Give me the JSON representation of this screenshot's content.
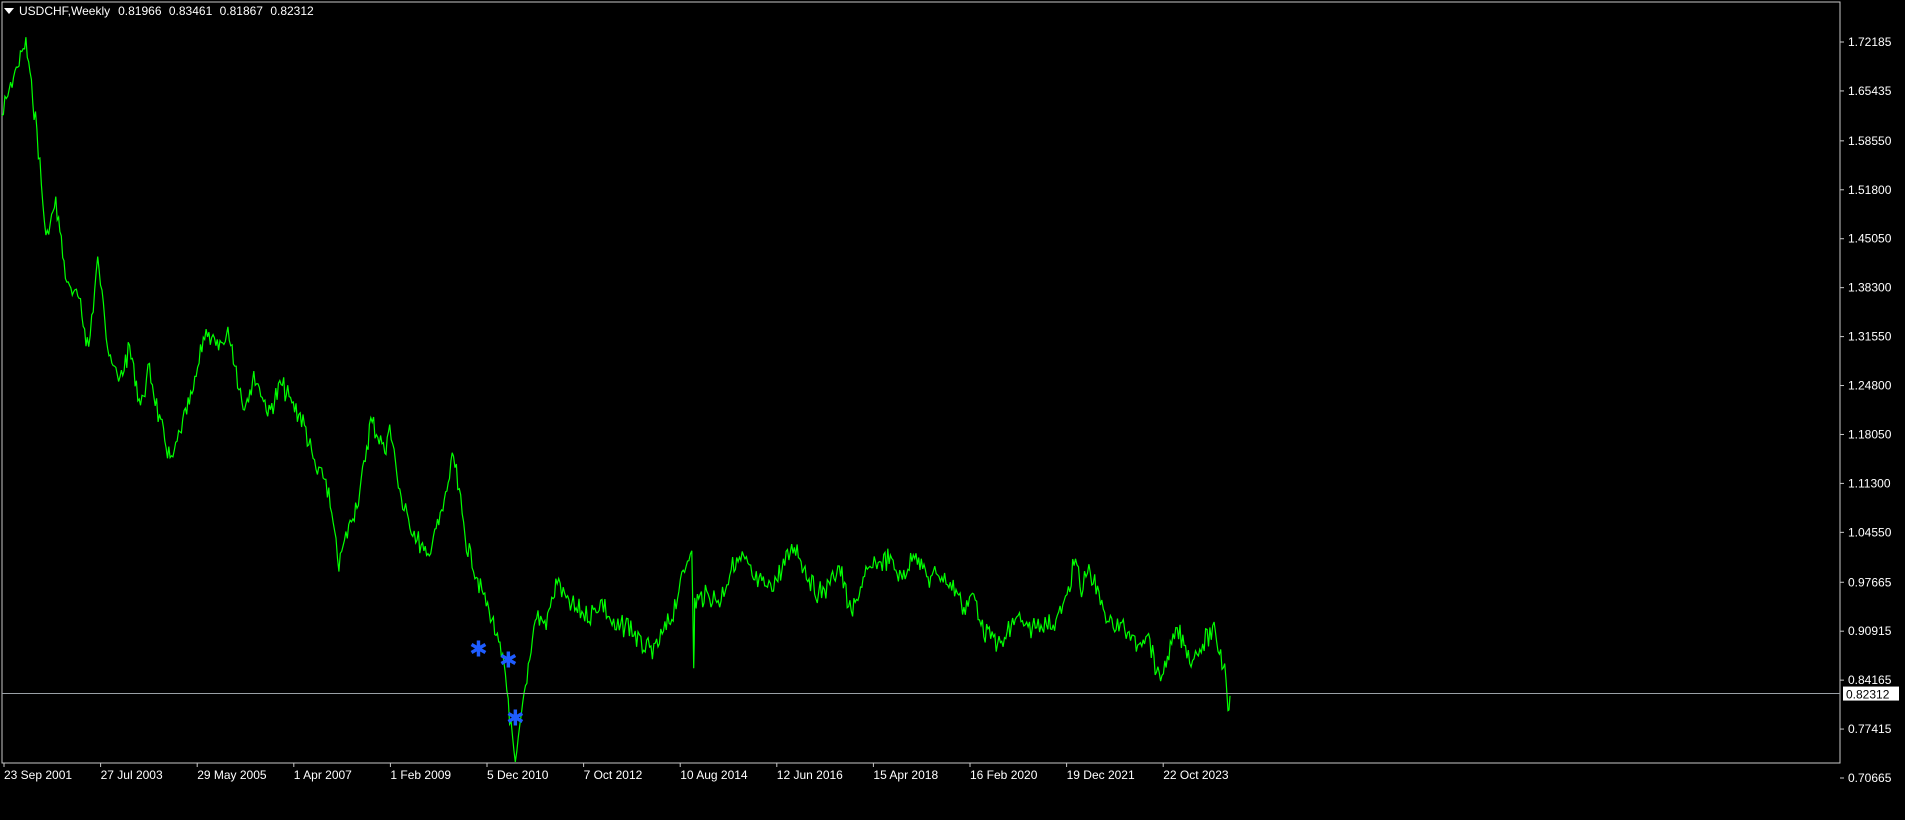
{
  "header": {
    "symbol_timeframe": "USDCHF,Weekly",
    "open": "0.81966",
    "high": "0.83461",
    "low": "0.81867",
    "close": "0.82312"
  },
  "colors": {
    "background": "#000000",
    "price_line": "#00ff00",
    "marker": "#1e5cff",
    "axis_text": "#ffffff",
    "frame": "#c8c8c8"
  },
  "chart_data": {
    "type": "line",
    "title": "USDCHF,Weekly",
    "xlabel": "",
    "ylabel": "",
    "ylim": [
      0.67,
      1.765
    ],
    "grid": false,
    "y_ticks": [
      "1.72185",
      "1.65435",
      "1.58550",
      "1.51800",
      "1.45050",
      "1.38300",
      "1.31550",
      "1.24800",
      "1.18050",
      "1.11300",
      "1.04550",
      "0.97665",
      "0.90915",
      "0.84165",
      "0.77415",
      "0.70665"
    ],
    "x_ticks": [
      "23 Sep 2001",
      "27 Jul 2003",
      "29 May 2005",
      "1 Apr 2007",
      "1 Feb 2009",
      "5 Dec 2010",
      "7 Oct 2012",
      "10 Aug 2014",
      "12 Jun 2016",
      "15 Apr 2018",
      "16 Feb 2020",
      "19 Dec 2021",
      "22 Oct 2023"
    ],
    "current_price": "0.82312",
    "series": [
      {
        "x": [
          "2001-09-23",
          "2001-12-23",
          "2002-03-10",
          "2002-05-26",
          "2002-07-28",
          "2002-10-06",
          "2002-12-22",
          "2003-03-09",
          "2003-05-25",
          "2003-07-27",
          "2003-10-05",
          "2003-12-21",
          "2004-03-07",
          "2004-05-23",
          "2004-07-25",
          "2004-10-03",
          "2004-12-26",
          "2005-03-06",
          "2005-05-29",
          "2005-08-07",
          "2005-11-13",
          "2006-02-05",
          "2006-05-14",
          "2006-08-06",
          "2006-11-12",
          "2007-02-04",
          "2007-04-01",
          "2007-07-08",
          "2007-10-07",
          "2007-12-16",
          "2008-03-16",
          "2008-05-04",
          "2008-08-10",
          "2008-10-26",
          "2009-02-01",
          "2009-03-08",
          "2009-06-07",
          "2009-09-06",
          "2009-11-22",
          "2010-03-07",
          "2010-05-30",
          "2010-08-29",
          "2010-12-05",
          "2011-03-06",
          "2011-05-29",
          "2011-08-07",
          "2011-09-18",
          "2011-12-25",
          "2012-03-11",
          "2012-05-27",
          "2012-07-29",
          "2012-10-07",
          "2013-01-06",
          "2013-04-07",
          "2013-07-07",
          "2013-10-06",
          "2014-01-05",
          "2014-04-06",
          "2014-08-10",
          "2014-12-28",
          "2015-01-11",
          "2015-01-18",
          "2015-04-12",
          "2015-07-12",
          "2015-10-11",
          "2015-12-27",
          "2016-03-06",
          "2016-06-12",
          "2016-08-14",
          "2016-12-18",
          "2017-03-12",
          "2017-05-28",
          "2017-08-06",
          "2017-10-29",
          "2018-01-21",
          "2018-04-15",
          "2018-07-01",
          "2018-10-14",
          "2019-01-06",
          "2019-04-21",
          "2019-07-14",
          "2019-09-29",
          "2020-02-16",
          "2020-03-22",
          "2020-05-31",
          "2020-08-09",
          "2020-12-13",
          "2021-03-28",
          "2021-06-06",
          "2021-09-05",
          "2021-12-19",
          "2022-03-06",
          "2022-05-15",
          "2022-06-26",
          "2022-08-07",
          "2022-11-06",
          "2023-01-15",
          "2023-03-26",
          "2023-07-16",
          "2023-10-01",
          "2023-12-24",
          "2024-04-28",
          "2024-08-04",
          "2024-11-24",
          "2025-01-12",
          "2025-04-06",
          "2025-04-20",
          "2025-05-04"
        ],
        "values": [
          1.62,
          1.68,
          1.72,
          1.6,
          1.45,
          1.5,
          1.39,
          1.37,
          1.3,
          1.42,
          1.31,
          1.25,
          1.3,
          1.22,
          1.27,
          1.2,
          1.14,
          1.19,
          1.24,
          1.32,
          1.3,
          1.32,
          1.22,
          1.26,
          1.21,
          1.25,
          1.23,
          1.2,
          1.13,
          1.12,
          1.0,
          1.04,
          1.1,
          1.2,
          1.16,
          1.19,
          1.08,
          1.04,
          1.01,
          1.07,
          1.15,
          1.03,
          0.97,
          0.92,
          0.85,
          0.72,
          0.79,
          0.93,
          0.92,
          0.98,
          0.95,
          0.94,
          0.93,
          0.95,
          0.91,
          0.92,
          0.89,
          0.88,
          0.93,
          1.03,
          0.85,
          0.95,
          0.96,
          0.95,
          1.0,
          1.01,
          0.98,
          0.97,
          0.98,
          1.03,
          0.99,
          0.96,
          0.97,
          1.0,
          0.93,
          0.98,
          1.0,
          1.01,
          0.98,
          1.02,
          0.98,
          0.99,
          0.96,
          0.94,
          0.96,
          0.91,
          0.89,
          0.93,
          0.91,
          0.92,
          0.92,
          0.95,
          1.01,
          0.96,
          1.0,
          0.95,
          0.92,
          0.92,
          0.89,
          0.91,
          0.84,
          0.91,
          0.87,
          0.9,
          0.91,
          0.85,
          0.81,
          0.82
        ]
      }
    ],
    "markers": [
      {
        "x": "2010-11-21",
        "value": 0.885
      },
      {
        "x": "2011-06-19",
        "value": 0.87
      },
      {
        "x": "2011-08-07",
        "value": 0.79
      }
    ]
  }
}
